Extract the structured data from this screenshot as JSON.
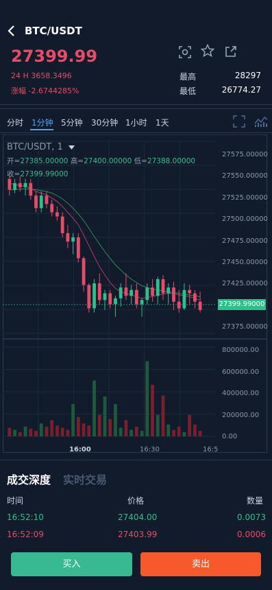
{
  "header": {
    "title": "BTC/USDT"
  },
  "ticker": {
    "last_price": "27399.99",
    "volume_24h": "24 H 3658.3496",
    "change": "涨幅 -2.6744285%",
    "high_label": "最高",
    "high_value": "28297",
    "low_label": "最低",
    "low_value": "26774.27"
  },
  "icons": [
    "scan-icon",
    "star-icon",
    "share-icon",
    "fullscreen-icon",
    "indicator-icon",
    "dropdown-caret-icon",
    "back-arrow-icon"
  ],
  "intervals": [
    "分时",
    "1分钟",
    "5分钟",
    "30分钟",
    "1小时",
    "1天"
  ],
  "active_interval": "1分钟",
  "chart": {
    "symbol": "BTC/USDT, 1",
    "open_label": "开=",
    "open_value": "27385.00000",
    "high_label": "高=",
    "high_value": "27400.00000",
    "low_label": "低=",
    "low_value": "27388.00000",
    "close_label": "收=",
    "close_value": "27399.99000",
    "last_tag": "27399.99000"
  },
  "chart_data": {
    "type": "candlestick",
    "price_axis": [
      "27575.00000",
      "27550.00000",
      "27525.00000",
      "27500.00000",
      "27475.00000",
      "27450.00000",
      "27425.00000",
      "27375.00000"
    ],
    "volume_axis": [
      "800000.00",
      "600000.00",
      "400000.00",
      "200000.00",
      "0.00"
    ],
    "time_axis": [
      "16:00",
      "16:30",
      "16:5"
    ],
    "ylim": [
      27360,
      27590
    ],
    "volume_ylim": [
      0,
      830000
    ],
    "up_color": "#2fbf8c",
    "down_color": "#e44d67",
    "ohlc": [
      [
        27545,
        27552,
        27525,
        27532
      ],
      [
        27532,
        27545,
        27528,
        27540
      ],
      [
        27540,
        27548,
        27530,
        27535
      ],
      [
        27535,
        27545,
        27525,
        27540
      ],
      [
        27540,
        27545,
        27520,
        27525
      ],
      [
        27525,
        27530,
        27505,
        27510
      ],
      [
        27510,
        27530,
        27505,
        27525
      ],
      [
        27525,
        27530,
        27510,
        27515
      ],
      [
        27515,
        27520,
        27500,
        27505
      ],
      [
        27505,
        27512,
        27495,
        27500
      ],
      [
        27500,
        27505,
        27475,
        27480
      ],
      [
        27480,
        27490,
        27462,
        27470
      ],
      [
        27470,
        27480,
        27455,
        27475
      ],
      [
        27475,
        27480,
        27445,
        27450
      ],
      [
        27450,
        27452,
        27410,
        27418
      ],
      [
        27418,
        27420,
        27385,
        27390
      ],
      [
        27390,
        27425,
        27385,
        27420
      ],
      [
        27420,
        27432,
        27395,
        27400
      ],
      [
        27400,
        27412,
        27388,
        27408
      ],
      [
        27408,
        27412,
        27390,
        27395
      ],
      [
        27395,
        27405,
        27380,
        27402
      ],
      [
        27402,
        27420,
        27392,
        27415
      ],
      [
        27415,
        27432,
        27400,
        27405
      ],
      [
        27405,
        27418,
        27395,
        27412
      ],
      [
        27412,
        27420,
        27390,
        27395
      ],
      [
        27395,
        27402,
        27380,
        27400
      ],
      [
        27400,
        27420,
        27395,
        27415
      ],
      [
        27415,
        27425,
        27398,
        27405
      ],
      [
        27405,
        27428,
        27395,
        27425
      ],
      [
        27425,
        27430,
        27400,
        27408
      ],
      [
        27408,
        27420,
        27395,
        27415
      ],
      [
        27415,
        27422,
        27388,
        27398
      ],
      [
        27398,
        27412,
        27385,
        27390
      ],
      [
        27390,
        27420,
        27388,
        27412
      ],
      [
        27412,
        27418,
        27395,
        27408
      ],
      [
        27408,
        27412,
        27390,
        27398
      ],
      [
        27398,
        27410,
        27385,
        27388
      ]
    ],
    "volumes": [
      80000,
      60000,
      40000,
      90000,
      70000,
      50000,
      120000,
      90000,
      150000,
      100000,
      80000,
      60000,
      300000,
      180000,
      120000,
      100000,
      520000,
      200000,
      370000,
      160000,
      300000,
      80000,
      150000,
      60000,
      90000,
      50000,
      700000,
      480000,
      200000,
      380000,
      110000,
      60000,
      90000,
      40000,
      200000,
      110000,
      50000
    ],
    "ma_lines": [
      {
        "color": "#b03a6a",
        "values": [
          27540,
          27538,
          27537,
          27536,
          27534,
          27530,
          27528,
          27526,
          27522,
          27518,
          27512,
          27505,
          27498,
          27490,
          27478,
          27465,
          27452,
          27440,
          27430,
          27421,
          27414,
          27410,
          27408,
          27406,
          27404,
          27402,
          27403,
          27404,
          27406,
          27407,
          27408,
          27408,
          27406,
          27405,
          27404,
          27402,
          27400
        ]
      },
      {
        "color": "#2e8b57",
        "values": [
          27532,
          27532,
          27533,
          27533,
          27533,
          27532,
          27531,
          27530,
          27528,
          27525,
          27521,
          27516,
          27510,
          27503,
          27495,
          27486,
          27476,
          27467,
          27458,
          27450,
          27442,
          27436,
          27430,
          27425,
          27421,
          27417,
          27415,
          27413,
          27412,
          27411,
          27410,
          27409,
          27408,
          27407,
          27406,
          27405,
          27404
        ]
      }
    ]
  },
  "trades": {
    "tab_depth": "成交深度",
    "tab_realtime": "实时交易",
    "col_time": "时间",
    "col_price": "价格",
    "col_qty": "数量",
    "rows": [
      {
        "time": "16:52:10",
        "price": "27404.00",
        "qty": "0.0073",
        "side": "buy"
      },
      {
        "time": "16:52:09",
        "price": "27403.99",
        "qty": "0.0006",
        "side": "sell"
      }
    ]
  },
  "actions": {
    "buy": "买入",
    "sell": "卖出"
  }
}
